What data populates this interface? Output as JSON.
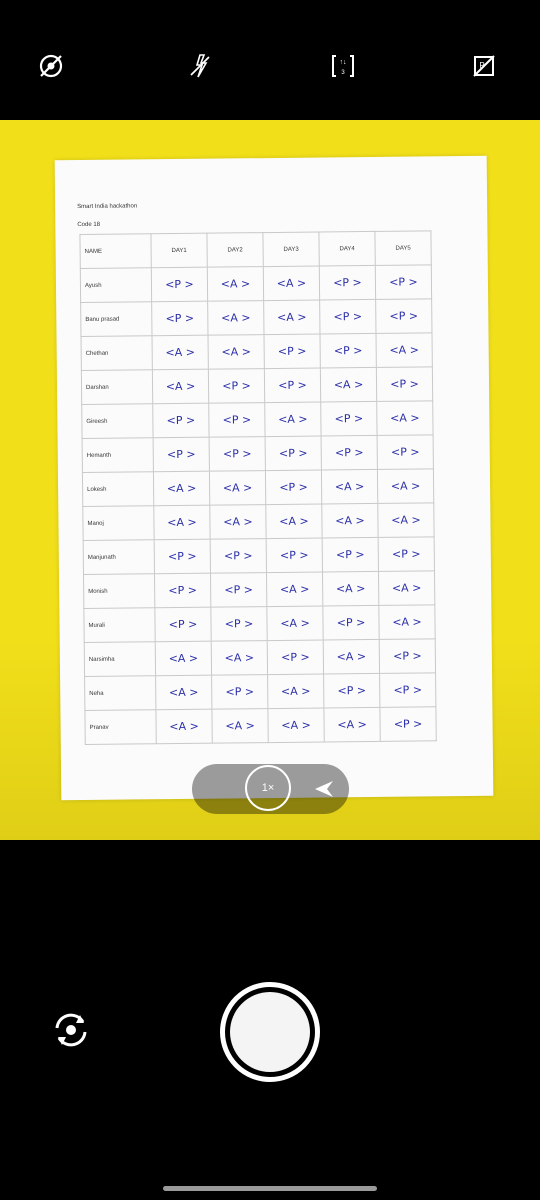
{
  "top_bar": {
    "icons": [
      "motion-photo-off-icon",
      "flash-off-icon",
      "aspect-ratio-icon",
      "hdr-off-icon"
    ]
  },
  "document": {
    "title": "Smart India hackathon",
    "code": "Code 18",
    "headers": [
      "NAME",
      "DAY1",
      "DAY2",
      "DAY3",
      "DAY4",
      "DAY5"
    ],
    "rows": [
      {
        "name": "Ayush",
        "days": [
          "<P >",
          "<A >",
          "<A >",
          "<P >",
          "<P >"
        ]
      },
      {
        "name": "Banu prasad",
        "days": [
          "<P >",
          "<A >",
          "<A >",
          "<P >",
          "<P >"
        ]
      },
      {
        "name": "Chethan",
        "days": [
          "<A >",
          "<A >",
          "<P >",
          "<P >",
          "<A >"
        ]
      },
      {
        "name": "Darshan",
        "days": [
          "<A >",
          "<P >",
          "<P >",
          "<A >",
          "<P >"
        ]
      },
      {
        "name": "Gireesh",
        "days": [
          "<P >",
          "<P >",
          "<A >",
          "<P >",
          "<A >"
        ]
      },
      {
        "name": "Hemanth",
        "days": [
          "<P >",
          "<P >",
          "<P >",
          "<P >",
          "<P >"
        ]
      },
      {
        "name": "Lokesh",
        "days": [
          "<A >",
          "<A >",
          "<P >",
          "<A >",
          "<A >"
        ]
      },
      {
        "name": "Manoj",
        "days": [
          "<A >",
          "<A >",
          "<A >",
          "<A >",
          "<A >"
        ]
      },
      {
        "name": "Manjunath",
        "days": [
          "<P >",
          "<P >",
          "<P >",
          "<P >",
          "<P >"
        ]
      },
      {
        "name": "Monish",
        "days": [
          "<P >",
          "<P >",
          "<A >",
          "<A >",
          "<A >"
        ]
      },
      {
        "name": "Murali",
        "days": [
          "<P >",
          "<P >",
          "<A >",
          "<P >",
          "<A >"
        ]
      },
      {
        "name": "Narsimha",
        "days": [
          "<A >",
          "<A >",
          "<P >",
          "<A >",
          "<P >"
        ]
      },
      {
        "name": "Neha",
        "days": [
          "<A >",
          "<P >",
          "<A >",
          "<P >",
          "<P >"
        ]
      },
      {
        "name": "Pranav",
        "days": [
          "<A >",
          "<A >",
          "<A >",
          "<A >",
          "<P >"
        ]
      }
    ]
  },
  "scan_modes": {
    "selected_label": "1×",
    "icons": [
      "multi-scan-icon",
      "single-scan-icon",
      "auto-capture-icon"
    ]
  },
  "controls": {
    "icons": [
      "switch-camera-icon",
      "shutter-icon"
    ]
  }
}
